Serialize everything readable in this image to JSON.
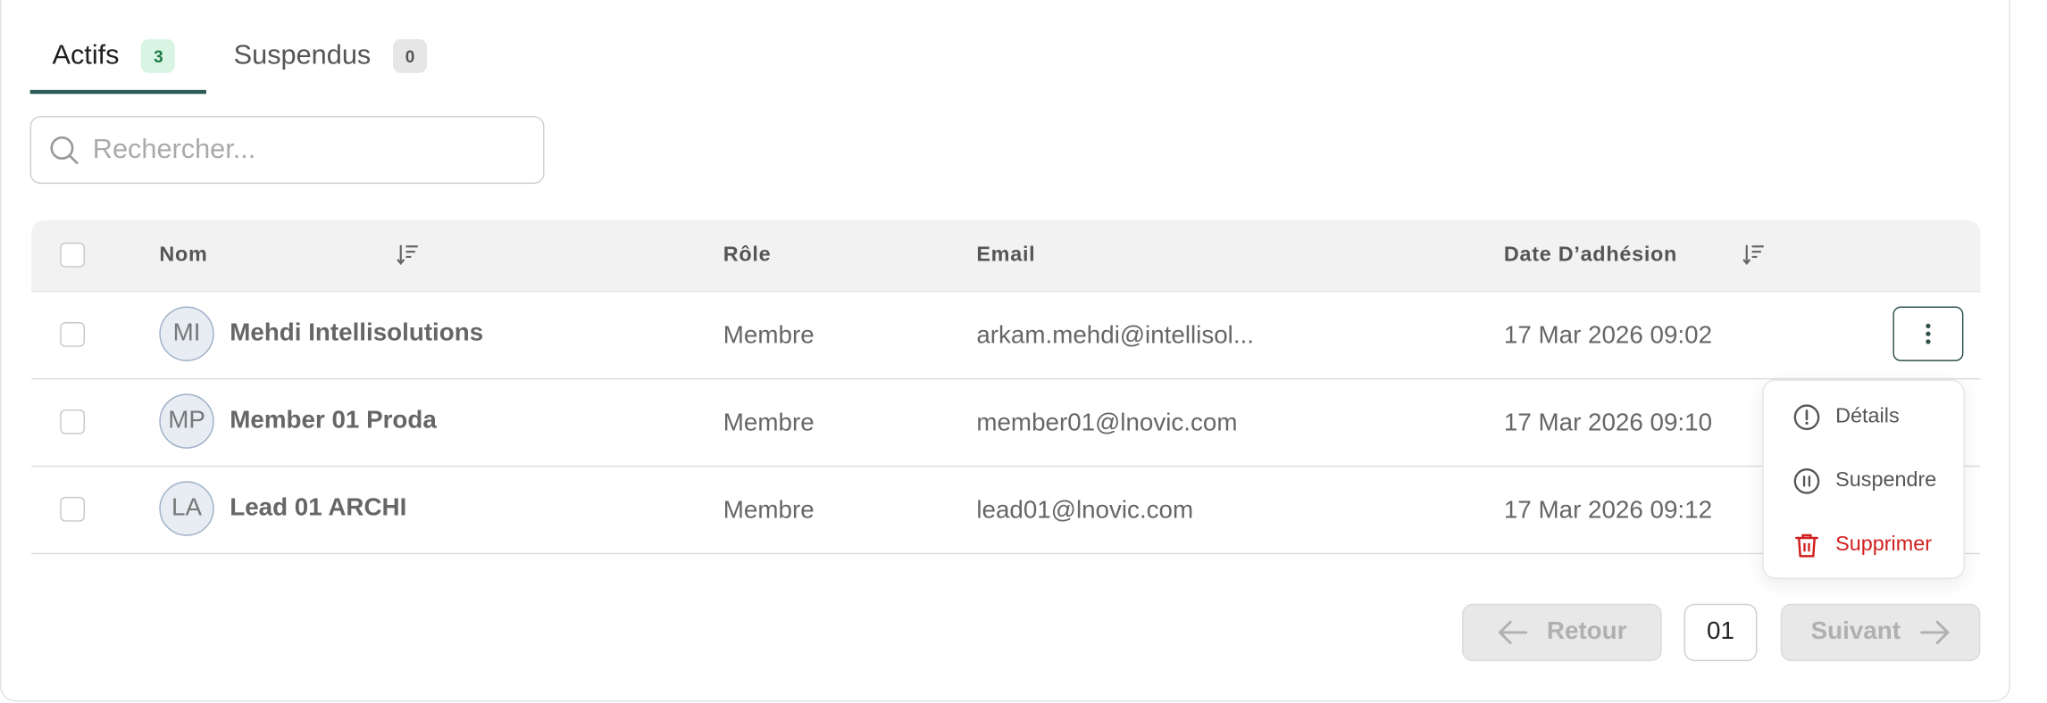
{
  "tabs": [
    {
      "label": "Actifs",
      "count": "3",
      "active": true
    },
    {
      "label": "Suspendus",
      "count": "0",
      "active": false
    }
  ],
  "search": {
    "placeholder": "Rechercher..."
  },
  "table": {
    "columns": [
      "Nom",
      "Rôle",
      "Email",
      "Date D’adhésion"
    ],
    "rows": [
      {
        "initials": "MI",
        "name": "Mehdi Intellisolutions",
        "role": "Membre",
        "email": "arkam.mehdi@intellisol...",
        "date": "17 Mar 2026  09:02"
      },
      {
        "initials": "MP",
        "name": "Member 01 Proda",
        "role": "Membre",
        "email": "member01@lnovic.com",
        "date": "17 Mar 2026  09:10"
      },
      {
        "initials": "LA",
        "name": "Lead 01 ARCHI",
        "role": "Membre",
        "email": "lead01@lnovic.com",
        "date": "17 Mar 2026  09:12"
      }
    ]
  },
  "menu": {
    "items": [
      {
        "label": "Détails",
        "icon": "info-circle-icon"
      },
      {
        "label": "Suspendre",
        "icon": "pause-circle-icon"
      },
      {
        "label": "Supprimer",
        "icon": "trash-icon"
      }
    ]
  },
  "pagination": {
    "prev_label": "Retour",
    "page": "01",
    "next_label": "Suivant"
  },
  "colors": {
    "accent": "#2a5b57",
    "danger": "#d11f1f",
    "badge_green_bg": "#d8f5e3",
    "badge_gray_bg": "#e6e6e6"
  }
}
